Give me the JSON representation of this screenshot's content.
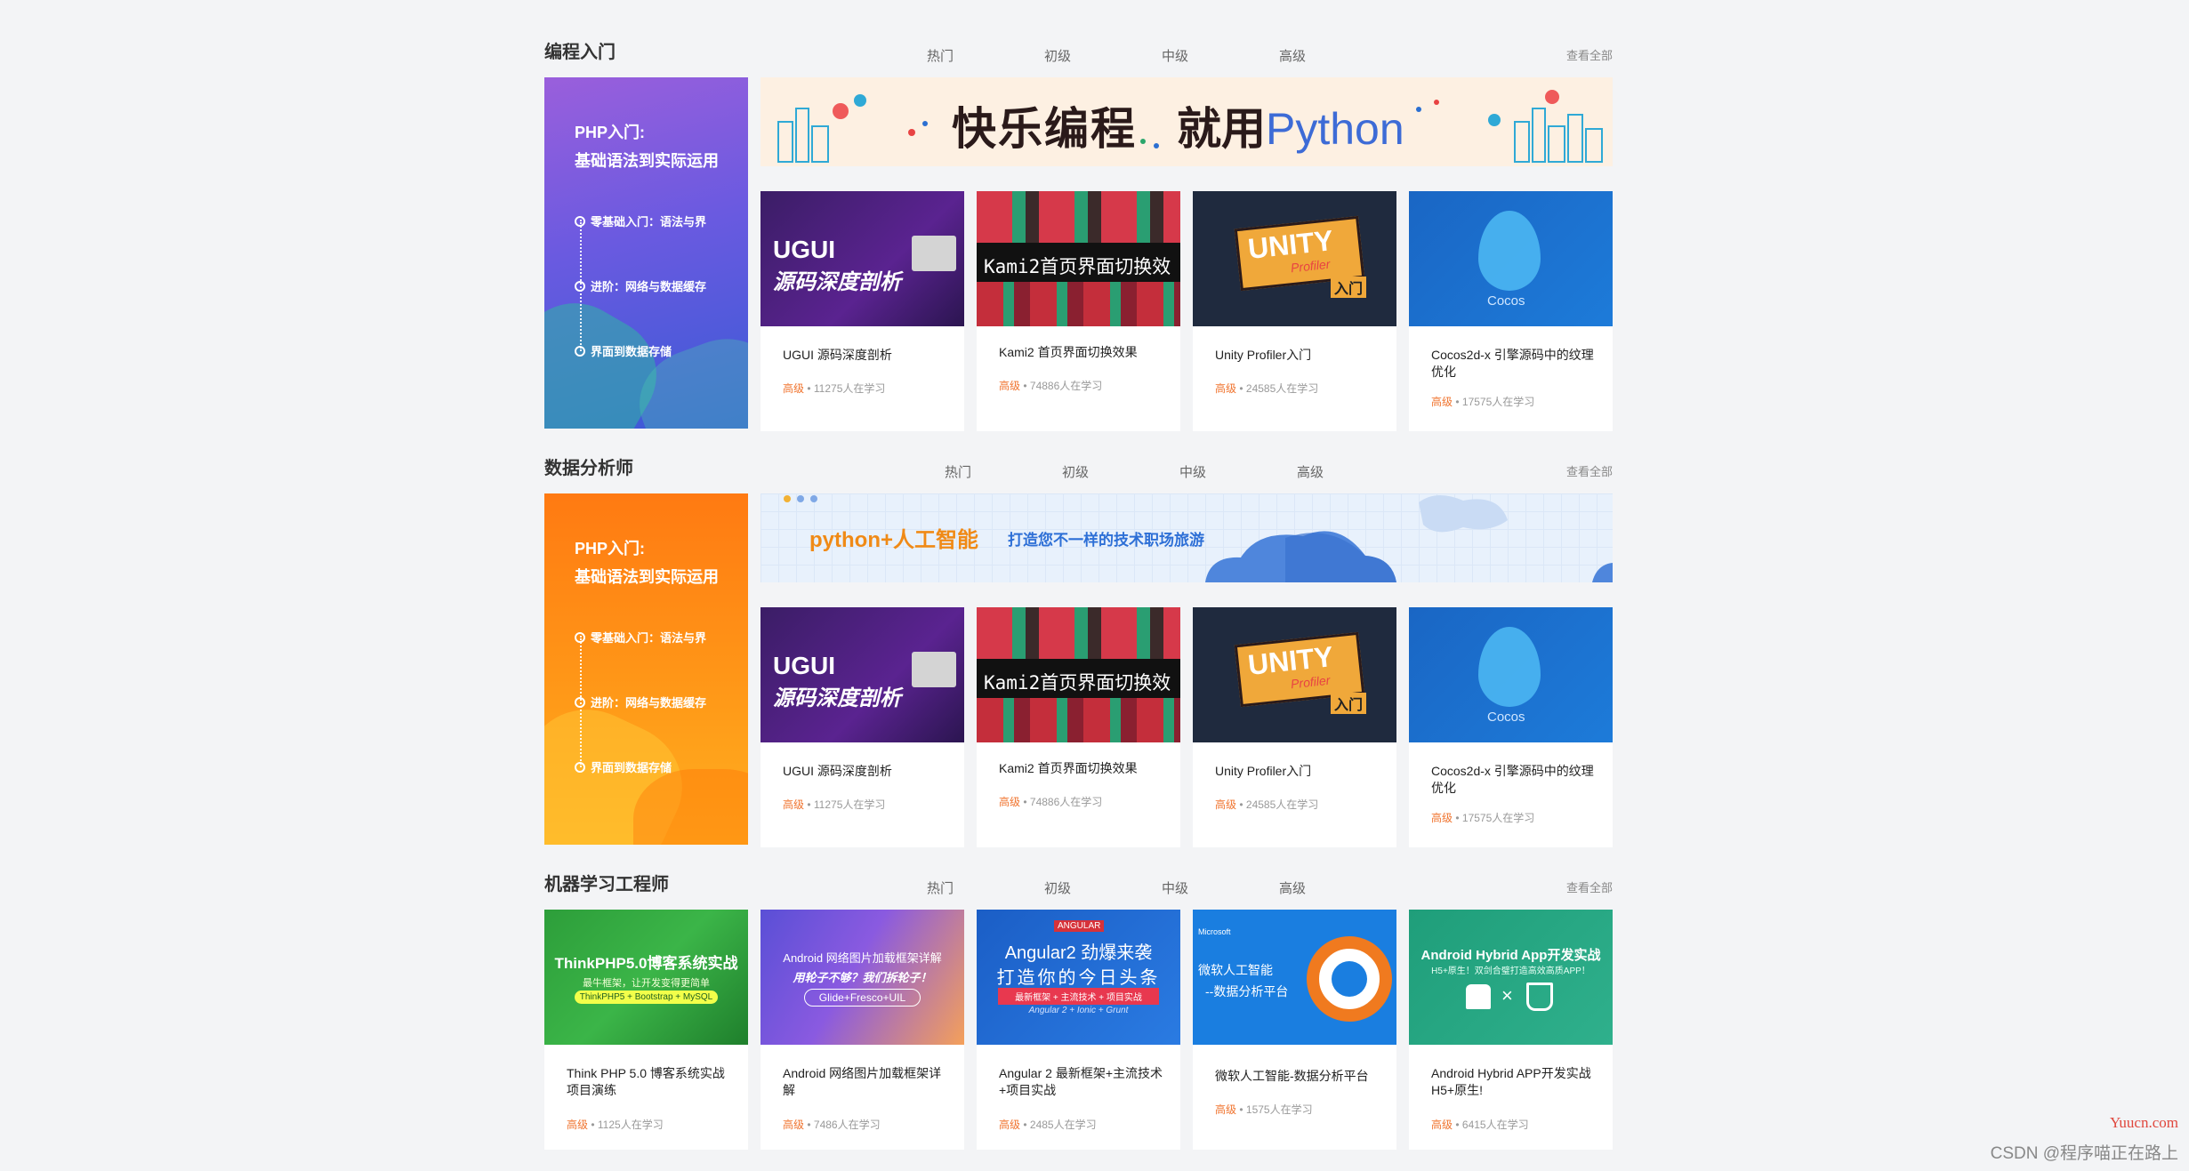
{
  "sections": [
    {
      "title": "编程入门",
      "tabs": [
        "热门",
        "初级",
        "中级",
        "高级"
      ],
      "view_all": "查看全部",
      "promo": {
        "title": "PHP入门:",
        "subtitle": "基础语法到实际运用",
        "steps": [
          "零基础入门：语法与界",
          "进阶：网络与数据缓存",
          "界面到数据存储"
        ],
        "color_top": "#8a5de0",
        "color_bottom": "#3858d8"
      },
      "banner": {
        "text1": "快乐编程",
        "text2": "就用",
        "text3": "Python"
      },
      "cards": [
        {
          "thumb_text": "UGUI",
          "thumb_sub": "源码深度剖析",
          "title": "UGUI 源码深度剖析",
          "level": "高级",
          "learners": "11275人在学习"
        },
        {
          "thumb_text": "Kami2首页界面切换效果",
          "title": "Kami2 首页界面切换效果",
          "level": "高级",
          "learners": "74886人在学习"
        },
        {
          "thumb_text": "UNITY",
          "thumb_sub": "Profiler",
          "thumb_sub2": "入门",
          "title": "Unity Profiler入门",
          "level": "高级",
          "learners": "24585人在学习"
        },
        {
          "thumb_text": "Cocos",
          "title": "Cocos2d-x 引擎源码中的纹理优化",
          "level": "高级",
          "learners": "17575人在学习"
        }
      ]
    },
    {
      "title": "数据分析师",
      "tabs": [
        "热门",
        "初级",
        "中级",
        "高级"
      ],
      "view_all": "查看全部",
      "promo": {
        "title": "PHP入门:",
        "subtitle": "基础语法到实际运用",
        "steps": [
          "零基础入门：语法与界",
          "进阶：网络与数据缓存",
          "界面到数据存储"
        ],
        "color_top": "#ff7a12",
        "color_bottom": "#ffa51c"
      },
      "banner": {
        "text1": "python+人工智能",
        "text2": "打造您不一样的技术职场旅游"
      },
      "cards": [
        {
          "thumb_text": "UGUI",
          "thumb_sub": "源码深度剖析",
          "title": "UGUI 源码深度剖析",
          "level": "高级",
          "learners": "11275人在学习"
        },
        {
          "thumb_text": "Kami2首页界面切换效果",
          "title": "Kami2 首页界面切换效果",
          "level": "高级",
          "learners": "74886人在学习"
        },
        {
          "thumb_text": "UNITY",
          "thumb_sub": "Profiler",
          "thumb_sub2": "入门",
          "title": "Unity Profiler入门",
          "level": "高级",
          "learners": "24585人在学习"
        },
        {
          "thumb_text": "Cocos",
          "title": "Cocos2d-x 引擎源码中的纹理优化",
          "level": "高级",
          "learners": "17575人在学习"
        }
      ]
    },
    {
      "title": "机器学习工程师",
      "tabs": [
        "热门",
        "初级",
        "中级",
        "高级"
      ],
      "view_all": "查看全部",
      "cards": [
        {
          "thumb_text": "ThinkPHP5.0博客系统实战",
          "thumb_sub": "最牛框架，让开发变得更简单",
          "thumb_sub2": "ThinkPHP5 + Bootstrap + MySQL",
          "title": "Think PHP 5.0 博客系统实战项目演练",
          "level": "高级",
          "learners": "1125人在学习"
        },
        {
          "thumb_text": "Android 网络图片加载框架详解",
          "thumb_sub": "用轮子不够？我们拆轮子！",
          "thumb_sub2": "Glide+Fresco+UIL",
          "title": "Android 网络图片加载框架详解",
          "level": "高级",
          "learners": "7486人在学习"
        },
        {
          "thumb_text": "Angular2 劲爆来袭",
          "thumb_sub": "打造你的今日头条",
          "thumb_sub2": "最新框架 + 主流技术 + 项目实战",
          "thumb_sub3": "Angular 2 + Ionic + Grunt",
          "thumb_badge": "ANGULAR",
          "title": "Angular 2 最新框架+主流技术+项目实战",
          "level": "高级",
          "learners": "2485人在学习"
        },
        {
          "thumb_text": "微软人工智能",
          "thumb_sub": "--数据分析平台",
          "thumb_badge": "Microsoft",
          "title": "微软人工智能-数据分析平台",
          "level": "高级",
          "learners": "1575人在学习"
        },
        {
          "thumb_text": "Android Hybrid App开发实战",
          "thumb_sub": "H5+原生！双剑合璧打造高效高质APP！",
          "title": "Android Hybrid APP开发实战 H5+原生!",
          "level": "高级",
          "learners": "6415人在学习"
        }
      ]
    }
  ],
  "watermark": {
    "site": "Yuucn.com",
    "author": "CSDN @程序喵正在路上"
  }
}
